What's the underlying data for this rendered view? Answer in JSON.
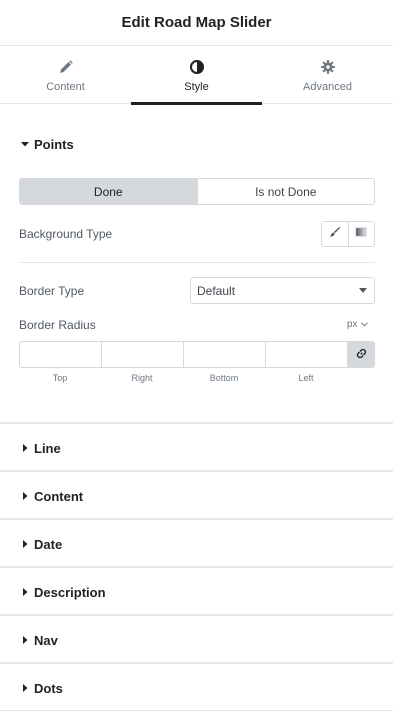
{
  "header": {
    "title": "Edit Road Map Slider"
  },
  "tabs": [
    {
      "label": "Content",
      "icon": "pencil-icon"
    },
    {
      "label": "Style",
      "icon": "half-circle-icon"
    },
    {
      "label": "Advanced",
      "icon": "gear-icon"
    }
  ],
  "active_tab": "Style",
  "points": {
    "title": "Points",
    "state_switcher": {
      "options": [
        "Done",
        "Is not Done"
      ],
      "selected": "Done"
    },
    "background_type_label": "Background Type",
    "background_type_options": [
      "brush-icon",
      "gradient-icon"
    ],
    "border_type_label": "Border Type",
    "border_type_value": "Default",
    "border_radius_label": "Border Radius",
    "unit": "px",
    "radius_fields": {
      "top": {
        "label": "Top",
        "value": ""
      },
      "right": {
        "label": "Right",
        "value": ""
      },
      "bottom": {
        "label": "Bottom",
        "value": ""
      },
      "left": {
        "label": "Left",
        "value": ""
      }
    }
  },
  "sections": [
    {
      "label": "Line"
    },
    {
      "label": "Content"
    },
    {
      "label": "Date"
    },
    {
      "label": "Description"
    },
    {
      "label": "Nav"
    },
    {
      "label": "Dots"
    }
  ],
  "colors": {
    "text_dark": "#1f2124",
    "text": "#3f444b",
    "muted": "#6d7882",
    "border": "#d5d8dc",
    "active_toggle": "#d5d8dc"
  }
}
